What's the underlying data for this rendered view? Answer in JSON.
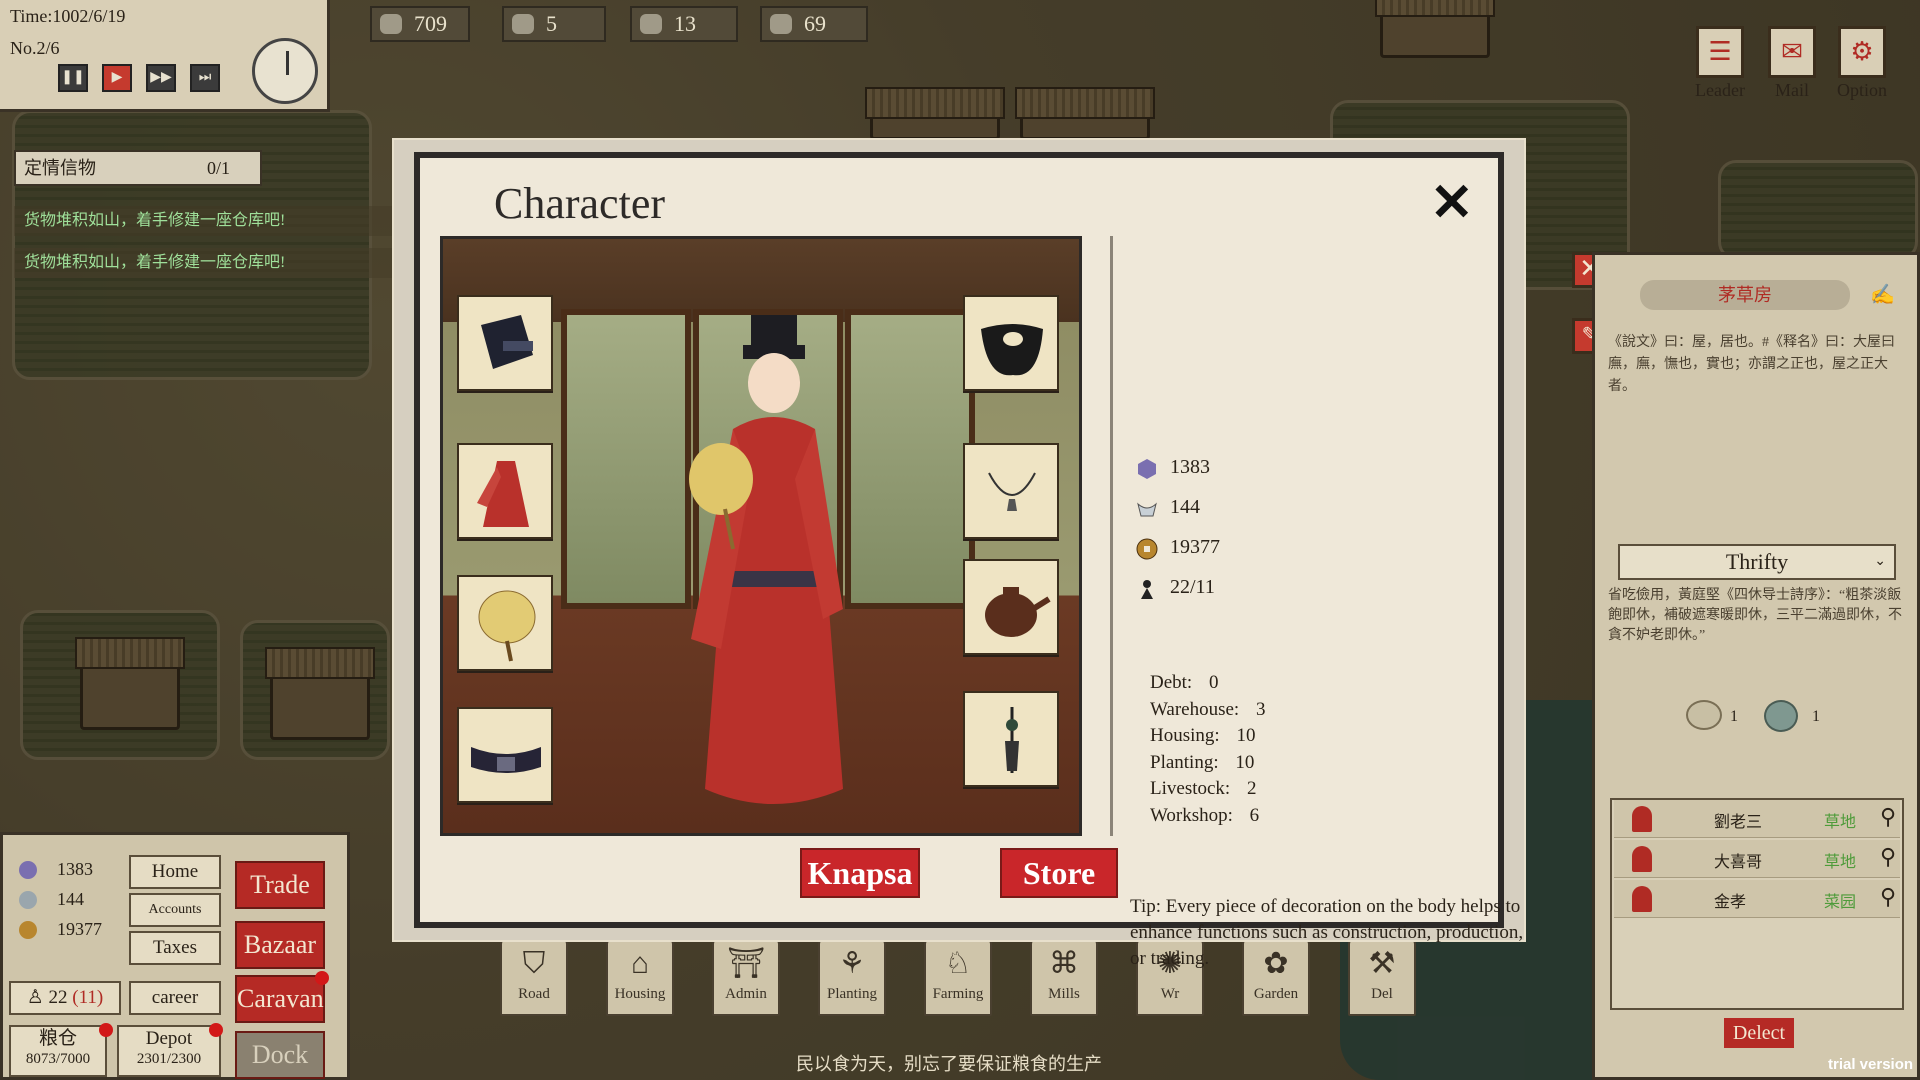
{
  "hud": {
    "time": "Time:1002/6/19",
    "number": "No.2/6",
    "controls": [
      "pause-icon",
      "play-icon",
      "fast-forward-icon",
      "fastest-icon"
    ],
    "resources": [
      "709",
      "5",
      "13",
      "69"
    ]
  },
  "quest": {
    "label": "定情信物",
    "count": "0/1"
  },
  "messages": [
    "货物堆积如山，着手修建一座仓库吧!",
    "货物堆积如山，着手修建一座仓库吧!"
  ],
  "top_right": {
    "leader": "Leader",
    "mail": "Mail",
    "option": "Option"
  },
  "bottom_left": {
    "stats": [
      "1383",
      "144",
      "19377"
    ],
    "home": "Home",
    "accounts": "Accounts",
    "taxes": "Taxes",
    "trade": "Trade",
    "bazaar": "Bazaar",
    "caravan": "Caravan",
    "dock": "Dock",
    "pop": "22",
    "pop_sub": "(11)",
    "career": "career",
    "granary_label": "粮仓",
    "granary": "8073/7000",
    "depot_label": "Depot",
    "depot": "2301/2300"
  },
  "build_bar": [
    {
      "label": "Road",
      "glyph": "⛉"
    },
    {
      "label": "Housing",
      "glyph": "⌂"
    },
    {
      "label": "Admin",
      "glyph": "⛩"
    },
    {
      "label": "Planting",
      "glyph": "⚘"
    },
    {
      "label": "Farming",
      "glyph": "♘"
    },
    {
      "label": "Mills",
      "glyph": "⌘"
    },
    {
      "label": "Wr",
      "glyph": "✺"
    },
    {
      "label": "Garden",
      "glyph": "✿"
    },
    {
      "label": "Del",
      "glyph": "⚒"
    }
  ],
  "bottom_hint": "民以食为天，别忘了要保证粮食的生产",
  "right_panel": {
    "title": "茅草房",
    "text": "《說文》曰：屋，居也。#《释名》曰：大屋曰廡，廡，憮也，實也；亦謂之正也，屋之正大者。",
    "trait": "Thrifty",
    "trait_text": "省吃儉用，黃庭堅《四休导士詩序》：“粗茶淡飯飽即休，補破遮寒暖即休，三平二滿過即休，不貪不妒老即休。”",
    "items": [
      "1",
      "1"
    ],
    "people": [
      {
        "name": "劉老三",
        "tag": "草地"
      },
      {
        "name": "大喜哥",
        "tag": "草地"
      },
      {
        "name": "金孝",
        "tag": "菜园"
      }
    ],
    "delect": "Delect"
  },
  "modal": {
    "title": "Character",
    "stats": [
      "1383",
      "144",
      "19377",
      "22/11"
    ],
    "attributes": [
      {
        "k": "Debt:",
        "v": "0"
      },
      {
        "k": "Warehouse:",
        "v": "3"
      },
      {
        "k": "Housing:",
        "v": "10"
      },
      {
        "k": "Planting:",
        "v": "10"
      },
      {
        "k": "Livestock:",
        "v": "2"
      },
      {
        "k": "Workshop:",
        "v": "6"
      }
    ],
    "tip": "Tip: Every piece of decoration on the body helps to enhance functions such as construction, production, or trading.",
    "knapsack": "Knapsa",
    "store": "Store"
  },
  "trial": "trial version",
  "colors": {
    "accent_red": "#c9262a",
    "panel": "#efe8d9",
    "border": "#2d2a28"
  }
}
